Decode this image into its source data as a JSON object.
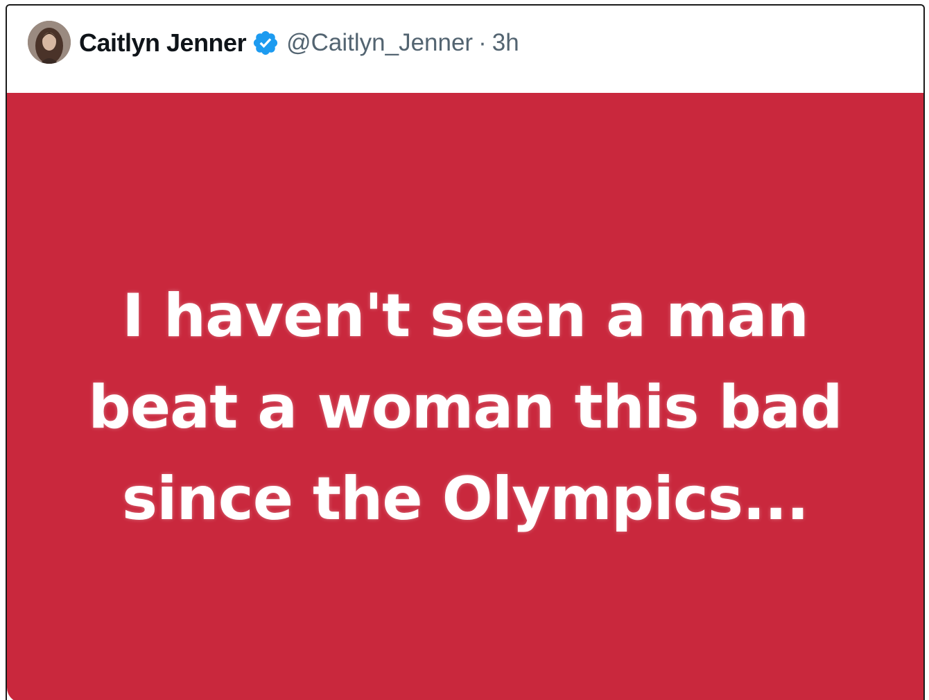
{
  "tweet": {
    "author": {
      "display_name": "Caitlyn Jenner",
      "handle": "@Caitlyn_Jenner",
      "verified_icon": "verified-badge-icon",
      "verified_color": "#1d9bf0"
    },
    "separator": "·",
    "timestamp": "3h",
    "media": {
      "background_color": "#c9283d",
      "text_lines": [
        "I haven't seen a man",
        "beat a woman this bad",
        "since the Olympics..."
      ]
    }
  }
}
